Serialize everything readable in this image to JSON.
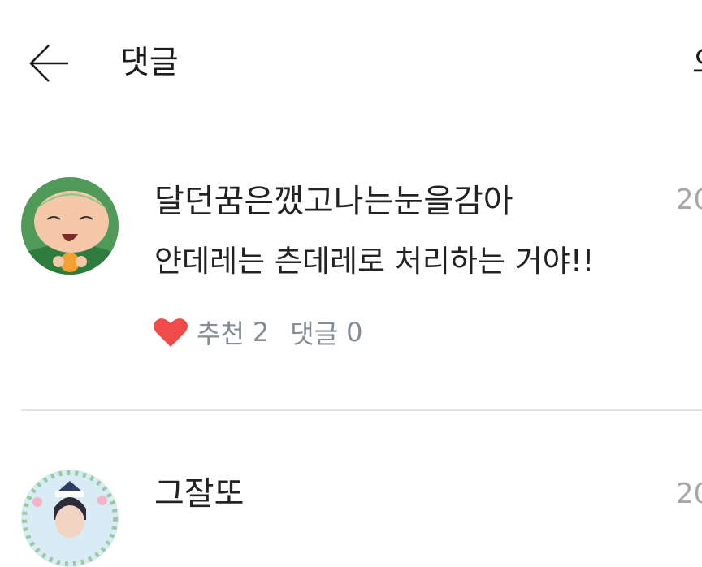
{
  "header": {
    "title": "댓글",
    "right_partial": "으"
  },
  "comments": [
    {
      "author": "달던꿈은깼고나는눈을감아",
      "date": "20",
      "text": "얀데레는 츤데레로 처리하는 거야!!",
      "like_label": "추천",
      "like_count": "2",
      "reply_label": "댓글",
      "reply_count": "0",
      "heart_color": "#f04a4a"
    },
    {
      "author": "그잘또",
      "date": "20"
    }
  ]
}
